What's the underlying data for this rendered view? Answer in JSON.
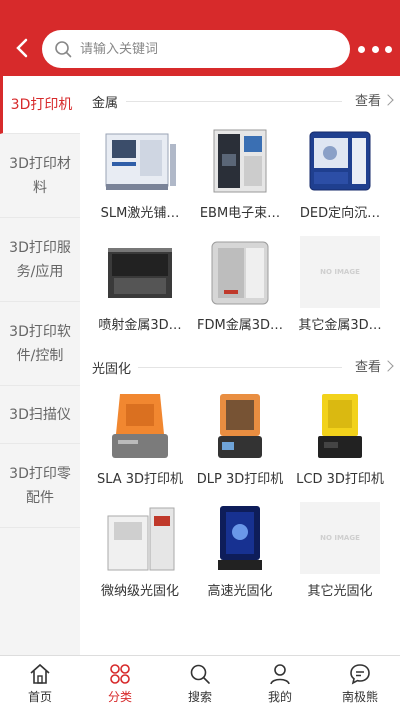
{
  "header": {
    "back_icon": "chevron-left-icon",
    "search_placeholder": "请输入关键词",
    "more_icon": "more-dots-icon"
  },
  "sidebar": {
    "items": [
      {
        "label": "3D打印机",
        "active": true
      },
      {
        "label": "3D打印材料",
        "active": false
      },
      {
        "label": "3D打印服务/应用",
        "active": false
      },
      {
        "label": "3D打印软件/控制",
        "active": false
      },
      {
        "label": "3D扫描仪",
        "active": false
      },
      {
        "label": "3D打印零配件",
        "active": false
      }
    ]
  },
  "sections": [
    {
      "title": "金属",
      "more": "查看",
      "items": [
        {
          "label": "SLM激光铺…",
          "icon": "metal-printer-icon"
        },
        {
          "label": "EBM电子束…",
          "icon": "metal-printer-icon"
        },
        {
          "label": "DED定向沉…",
          "icon": "metal-printer-icon"
        },
        {
          "label": "喷射金属3D…",
          "icon": "metal-printer-icon"
        },
        {
          "label": "FDM金属3D…",
          "icon": "metal-printer-icon"
        },
        {
          "label": "其它金属3D…",
          "icon": "no-image-placeholder"
        }
      ]
    },
    {
      "title": "光固化",
      "more": "查看",
      "items": [
        {
          "label": "SLA 3D打印机",
          "icon": "resin-printer-icon"
        },
        {
          "label": "DLP 3D打印机",
          "icon": "resin-printer-icon"
        },
        {
          "label": "LCD 3D打印机",
          "icon": "resin-printer-icon"
        },
        {
          "label": "微纳级光固化",
          "icon": "resin-printer-icon"
        },
        {
          "label": "高速光固化",
          "icon": "resin-printer-icon"
        },
        {
          "label": "其它光固化",
          "icon": "no-image-placeholder"
        }
      ]
    }
  ],
  "no_image_text": "NO IMAGE",
  "tabbar": [
    {
      "label": "首页",
      "icon": "home-icon",
      "active": false
    },
    {
      "label": "分类",
      "icon": "category-icon",
      "active": true
    },
    {
      "label": "搜索",
      "icon": "search-icon",
      "active": false
    },
    {
      "label": "我的",
      "icon": "user-icon",
      "active": false
    },
    {
      "label": "南极熊",
      "icon": "chat-icon",
      "active": false
    }
  ],
  "colors": {
    "accent": "#d72a2b",
    "sidebar_bg": "#f4f4f4"
  }
}
